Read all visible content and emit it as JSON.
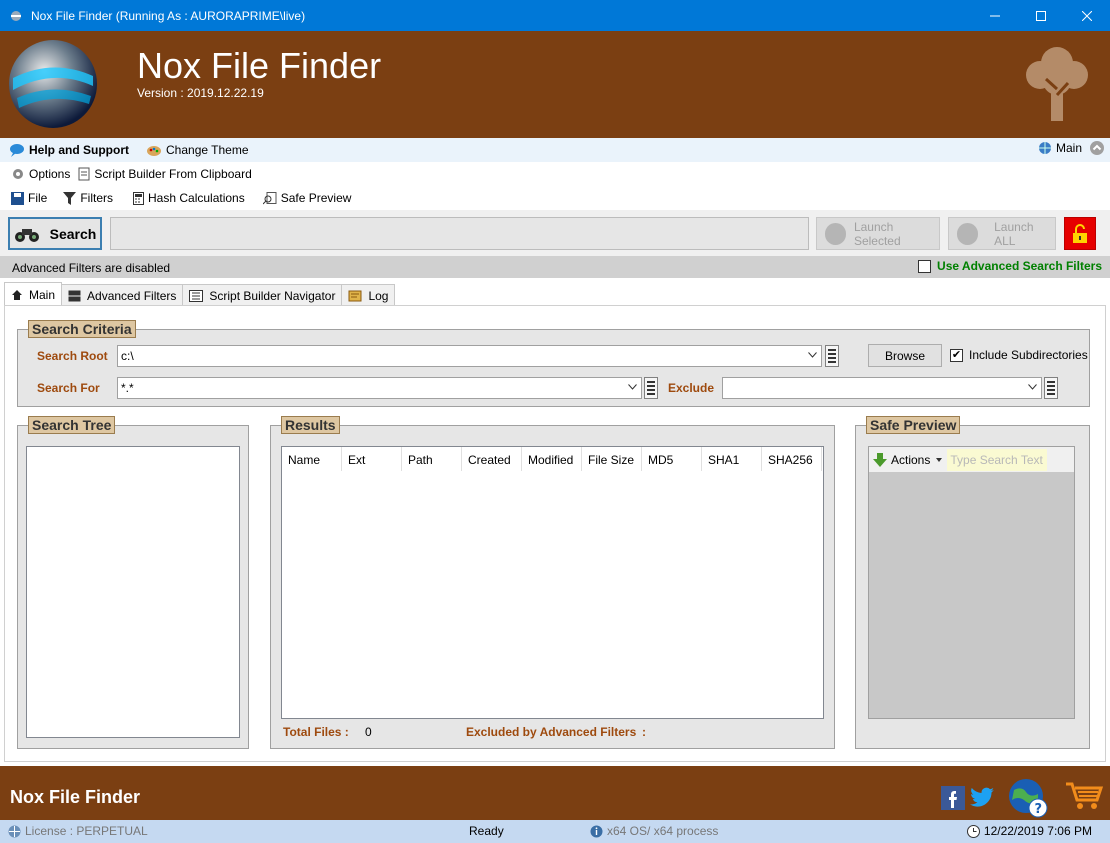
{
  "window": {
    "title": "Nox File Finder (Running As : AURORAPRIME\\live)"
  },
  "banner": {
    "app_name": "Nox File Finder",
    "version": "Version : 2019.12.22.19"
  },
  "menu_row1": {
    "help": "Help and Support",
    "theme": "Change Theme",
    "main": "Main"
  },
  "menu_row2": {
    "options": "Options",
    "script_builder": "Script Builder From Clipboard"
  },
  "menu_row3": {
    "file": "File",
    "filters": "Filters",
    "hash": "Hash Calculations",
    "safe_preview": "Safe Preview"
  },
  "toolbar": {
    "search": "Search",
    "launch_selected": "Launch Selected",
    "launch_all": "Launch ALL"
  },
  "advbar": {
    "message": "Advanced Filters are disabled",
    "use_advanced": "Use Advanced Search Filters",
    "use_advanced_checked": false
  },
  "tabs": [
    "Main",
    "Advanced Filters",
    "Script Builder Navigator",
    "Log"
  ],
  "search_criteria": {
    "title": "Search Criteria",
    "root_label": "Search Root",
    "root_value": "c:\\",
    "for_label": "Search For",
    "for_value": "*.*",
    "exclude_label": "Exclude",
    "exclude_value": "",
    "browse": "Browse",
    "include_sub": "Include Subdirectories",
    "include_sub_checked": true
  },
  "search_tree": {
    "title": "Search Tree"
  },
  "results": {
    "title": "Results",
    "columns": [
      "Name",
      "Ext",
      "Path",
      "Created",
      "Modified",
      "File Size",
      "MD5",
      "SHA1",
      "SHA256"
    ],
    "total_label": "Total Files :",
    "total_value": "0",
    "excluded_label": "Excluded by Advanced Filters",
    "excluded_sep": ":"
  },
  "safe_preview": {
    "title": "Safe Preview",
    "actions": "Actions",
    "search_placeholder": "Type Search Text"
  },
  "footer": {
    "brand": "Nox File Finder"
  },
  "status": {
    "license": "License : PERPETUAL",
    "state": "Ready",
    "arch": "x64 OS/ x64 process",
    "datetime": "12/22/2019 7:06 PM"
  }
}
